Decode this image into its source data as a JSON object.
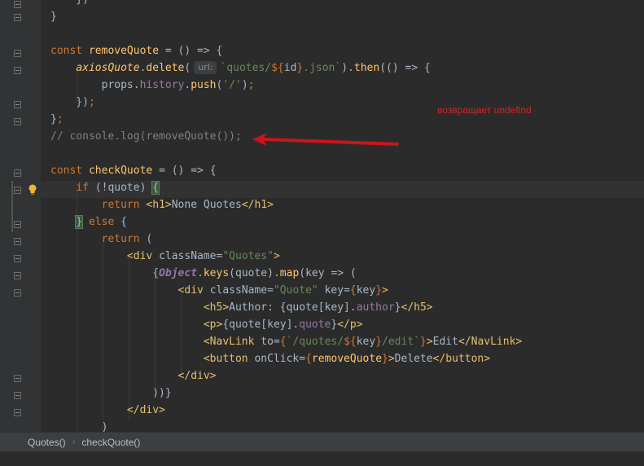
{
  "editor": {
    "lines": [
      [
        [
          "p",
          "    })"
        ]
      ],
      [
        [
          "p",
          "}"
        ]
      ],
      [
        [
          "p",
          ""
        ]
      ],
      [
        [
          "kw",
          "const "
        ],
        [
          "fn",
          "removeQuote"
        ],
        [
          "p",
          " = () => {"
        ]
      ],
      [
        [
          "p",
          "    "
        ],
        [
          "fni",
          "axiosQuote"
        ],
        [
          "p",
          "."
        ],
        [
          "fn",
          "delete"
        ],
        [
          "p",
          "("
        ],
        [
          "hint",
          "url:"
        ],
        [
          "str",
          "`quotes/"
        ],
        [
          "kw",
          "${"
        ],
        [
          "p",
          "id"
        ],
        [
          "kw",
          "}"
        ],
        [
          "str",
          ".json`"
        ],
        [
          "p",
          ")."
        ],
        [
          "fn",
          "then"
        ],
        [
          "p",
          "(() => {"
        ]
      ],
      [
        [
          "p",
          "        props."
        ],
        [
          "prop",
          "history"
        ],
        [
          "p",
          "."
        ],
        [
          "fn",
          "push"
        ],
        [
          "p",
          "("
        ],
        [
          "str",
          "'/'"
        ],
        [
          "p",
          ")"
        ],
        [
          "kw",
          ";"
        ]
      ],
      [
        [
          "p",
          "    })"
        ],
        [
          "kw",
          ";"
        ]
      ],
      [
        [
          "p",
          "}"
        ],
        [
          "kw",
          ";"
        ]
      ],
      [
        [
          "cmt",
          "// console.log(removeQuote());"
        ]
      ],
      [
        [
          "p",
          ""
        ]
      ],
      [
        [
          "kw",
          "const "
        ],
        [
          "fn",
          "checkQuote"
        ],
        [
          "p",
          " = () => {"
        ]
      ],
      [
        [
          "p",
          "    "
        ],
        [
          "kw",
          "if "
        ],
        [
          "p",
          "(!quote) "
        ],
        [
          "match",
          "{"
        ]
      ],
      [
        [
          "p",
          "        "
        ],
        [
          "kw",
          "return "
        ],
        [
          "tag",
          "<h1>"
        ],
        [
          "p",
          "None Quotes"
        ],
        [
          "tag",
          "</h1>"
        ]
      ],
      [
        [
          "p",
          "    "
        ],
        [
          "match",
          "}"
        ],
        [
          "p",
          " "
        ],
        [
          "kw",
          "else "
        ],
        [
          "p",
          "{"
        ]
      ],
      [
        [
          "p",
          "        "
        ],
        [
          "kw",
          "return "
        ],
        [
          "p",
          "("
        ]
      ],
      [
        [
          "p",
          "            "
        ],
        [
          "tag",
          "<div "
        ],
        [
          "p",
          "className="
        ],
        [
          "str",
          "\"Quotes\""
        ],
        [
          "tag",
          ">"
        ]
      ],
      [
        [
          "p",
          "                {"
        ],
        [
          "cls",
          "Object"
        ],
        [
          "p",
          "."
        ],
        [
          "fn",
          "keys"
        ],
        [
          "p",
          "(quote)."
        ],
        [
          "fn",
          "map"
        ],
        [
          "p",
          "(key => ("
        ]
      ],
      [
        [
          "p",
          "                    "
        ],
        [
          "tag",
          "<div "
        ],
        [
          "p",
          "className="
        ],
        [
          "str",
          "\"Quote\""
        ],
        [
          "p",
          " key="
        ],
        [
          "kw",
          "{"
        ],
        [
          "p",
          "key"
        ],
        [
          "kw",
          "}"
        ],
        [
          "tag",
          ">"
        ]
      ],
      [
        [
          "p",
          "                        "
        ],
        [
          "tag",
          "<h5>"
        ],
        [
          "p",
          "Author: {quote[key]."
        ],
        [
          "prop",
          "author"
        ],
        [
          "p",
          "}"
        ],
        [
          "tag",
          "</h5>"
        ]
      ],
      [
        [
          "p",
          "                        "
        ],
        [
          "tag",
          "<p>"
        ],
        [
          "p",
          "{quote[key]."
        ],
        [
          "prop",
          "quote"
        ],
        [
          "p",
          "}"
        ],
        [
          "tag",
          "</p>"
        ]
      ],
      [
        [
          "p",
          "                        "
        ],
        [
          "tag",
          "<NavLink "
        ],
        [
          "p",
          "to="
        ],
        [
          "kw",
          "{"
        ],
        [
          "str",
          "`/quotes/"
        ],
        [
          "kw",
          "${"
        ],
        [
          "p",
          "key"
        ],
        [
          "kw",
          "}"
        ],
        [
          "str",
          "/edit`"
        ],
        [
          "kw",
          "}"
        ],
        [
          "tag",
          ">"
        ],
        [
          "p",
          "Edit"
        ],
        [
          "tag",
          "</NavLink>"
        ]
      ],
      [
        [
          "p",
          "                        "
        ],
        [
          "tag",
          "<button "
        ],
        [
          "p",
          "onClick="
        ],
        [
          "kw",
          "{"
        ],
        [
          "fn",
          "removeQuote"
        ],
        [
          "kw",
          "}"
        ],
        [
          "tag",
          ">"
        ],
        [
          "p",
          "Delete"
        ],
        [
          "tag",
          "</button>"
        ]
      ],
      [
        [
          "p",
          "                    "
        ],
        [
          "tag",
          "</div>"
        ]
      ],
      [
        [
          "p",
          "                ))}"
        ]
      ],
      [
        [
          "p",
          "            "
        ],
        [
          "tag",
          "</div>"
        ]
      ],
      [
        [
          "p",
          "        )"
        ]
      ]
    ]
  },
  "annotation": {
    "text": "возвращает undefind",
    "color": "#d0262b"
  },
  "breadcrumbs": [
    "Quotes()",
    "checkQuote()"
  ],
  "colors": {
    "background": "#2b2b2b",
    "keyword": "#cc7832",
    "function": "#ffc66d",
    "string": "#6a8759",
    "tag": "#e8bf6a",
    "property": "#9876aa",
    "comment": "#808080",
    "text": "#a9b7c6"
  },
  "icons": {
    "gutter": "fold-marker-icon",
    "intention": "lightbulb-icon",
    "arrow": "red-arrow-icon"
  }
}
